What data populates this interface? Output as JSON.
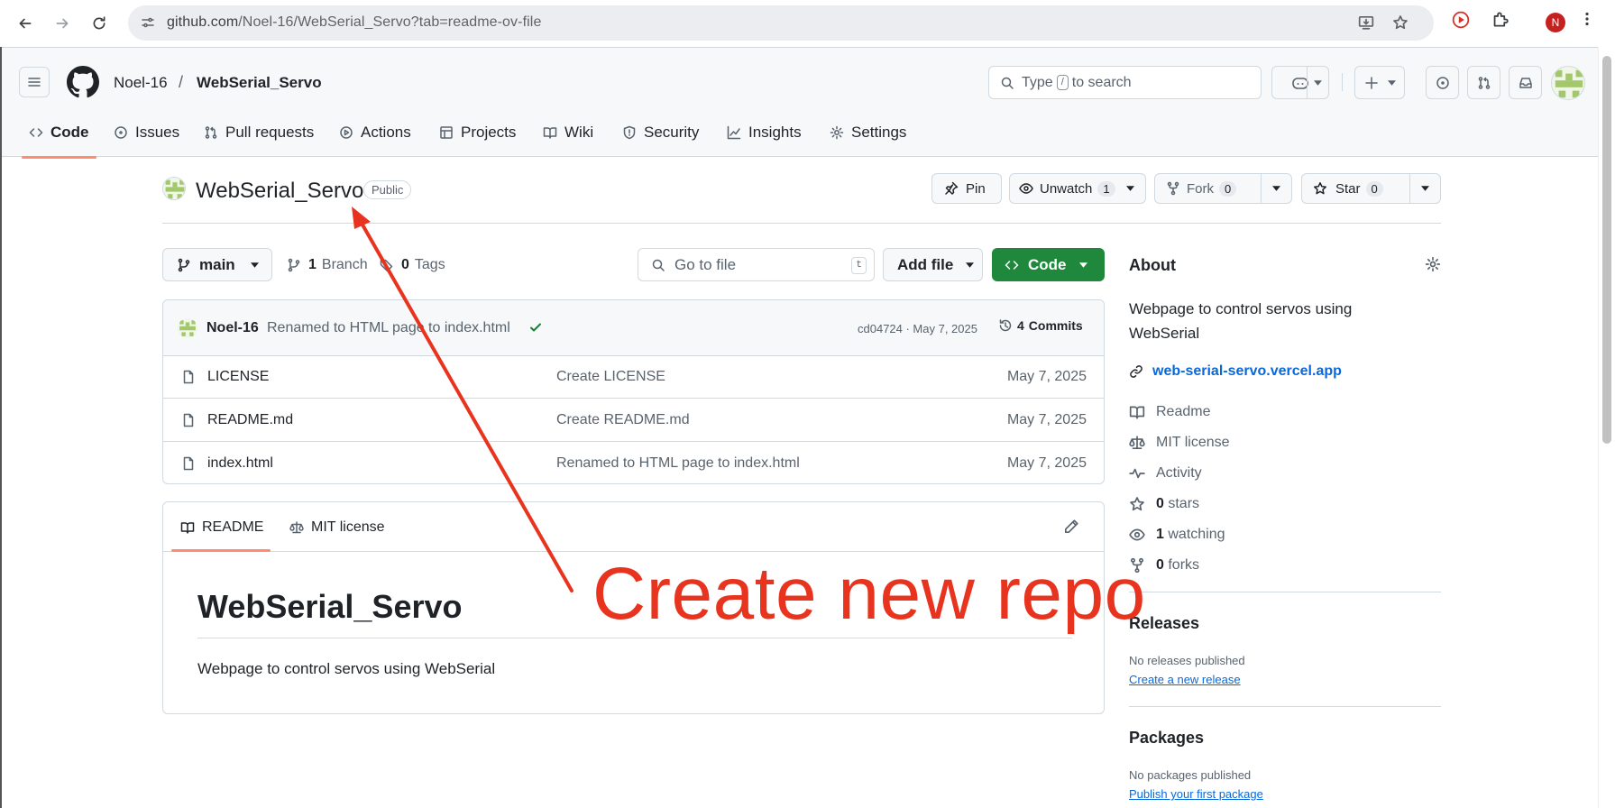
{
  "browser": {
    "url_host": "github.com",
    "url_path": "/Noel-16/WebSerial_Servo?tab=readme-ov-file",
    "profile_initial": "N"
  },
  "header": {
    "owner": "Noel-16",
    "separator": "/",
    "repo": "WebSerial_Servo",
    "search_prefix": "Type",
    "search_key": "/",
    "search_suffix": "to search"
  },
  "repo_nav": {
    "tabs": [
      {
        "label": "Code",
        "icon": "code-icon",
        "selected": true
      },
      {
        "label": "Issues",
        "icon": "issue-icon"
      },
      {
        "label": "Pull requests",
        "icon": "pull-request-icon"
      },
      {
        "label": "Actions",
        "icon": "play-icon"
      },
      {
        "label": "Projects",
        "icon": "table-icon"
      },
      {
        "label": "Wiki",
        "icon": "book-icon"
      },
      {
        "label": "Security",
        "icon": "shield-icon"
      },
      {
        "label": "Insights",
        "icon": "graph-icon"
      },
      {
        "label": "Settings",
        "icon": "gear-icon"
      }
    ]
  },
  "repo": {
    "title": "WebSerial_Servo",
    "visibility": "Public",
    "pin_label": "Pin",
    "unwatch_label": "Unwatch",
    "watch_count": "1",
    "fork_label": "Fork",
    "fork_count": "0",
    "star_label": "Star",
    "star_count": "0"
  },
  "toolbar": {
    "branch": "main",
    "branch_count": "1",
    "branch_word": "Branch",
    "tag_count": "0",
    "tag_word": "Tags",
    "goto_placeholder": "Go to file",
    "goto_key": "t",
    "add_file": "Add file",
    "code": "Code"
  },
  "commit": {
    "author": "Noel-16",
    "message": "Renamed to HTML page to index.html",
    "hash_date": "cd04724 · May 7, 2025",
    "commits_count": "4",
    "commits_word": "Commits"
  },
  "files": [
    {
      "name": "LICENSE",
      "message": "Create LICENSE",
      "date": "May 7, 2025"
    },
    {
      "name": "README.md",
      "message": "Create README.md",
      "date": "May 7, 2025"
    },
    {
      "name": "index.html",
      "message": "Renamed to HTML page to index.html",
      "date": "May 7, 2025"
    }
  ],
  "readme": {
    "tab_readme": "README",
    "tab_license": "MIT license",
    "heading": "WebSerial_Servo",
    "body": "Webpage to control servos using WebSerial"
  },
  "about": {
    "heading": "About",
    "description": "Webpage to control servos using WebSerial",
    "link": "web-serial-servo.vercel.app",
    "readme": "Readme",
    "license": "MIT license",
    "activity": "Activity",
    "stars_count": "0",
    "stars_word": "stars",
    "watching_count": "1",
    "watching_word": "watching",
    "forks_count": "0",
    "forks_word": "forks"
  },
  "releases": {
    "heading": "Releases",
    "none": "No releases published",
    "link": "Create a new release"
  },
  "packages": {
    "heading": "Packages",
    "none": "No packages published",
    "link": "Publish your first package"
  },
  "annotation": {
    "text": "Create new repo",
    "color": "#e8341f"
  },
  "colors": {
    "accent_green": "#1f883d",
    "link_blue": "#0969da",
    "tab_underline": "#fd8c73"
  }
}
